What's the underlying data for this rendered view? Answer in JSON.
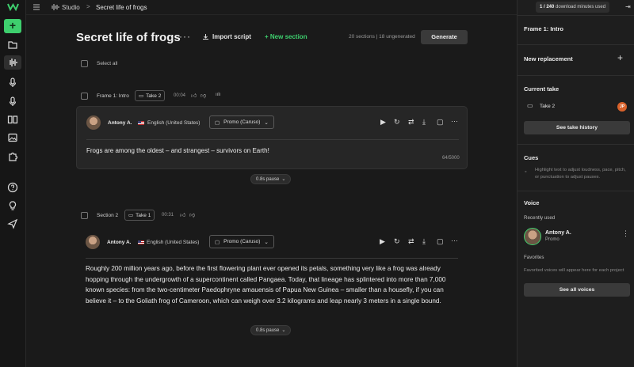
{
  "app": {
    "crumb_project": "Studio",
    "crumb_current": "Secret life of frogs",
    "crumb_sep": ">"
  },
  "rail": {
    "icons": [
      "logo-icon",
      "add-icon",
      "folder-icon",
      "waveform-icon",
      "mic-icon",
      "mic-alt-icon",
      "book-icon",
      "image-icon",
      "puzzle-icon",
      "help-icon",
      "lightbulb-icon",
      "send-icon"
    ]
  },
  "header": {
    "title": "Secret life of frogs",
    "more": "···",
    "import_label": "Import script",
    "new_section_label": "+ New section",
    "stats": "20 sections  |  18 ungenerated",
    "generate_label": "Generate",
    "select_all": "Select all"
  },
  "sections": [
    {
      "label": "Frame 1: Intro",
      "take": "Take 2",
      "duration": "00:04",
      "speaker": "Antony A.",
      "language": "English (United States)",
      "voice": "Promo (Caruso)",
      "text": "Frogs are among the oldest – and strangest – survivors on Earth!",
      "counter": "64/5000",
      "pause": "0.8s pause"
    },
    {
      "label": "Section 2",
      "take": "Take 1",
      "duration": "00:31",
      "speaker": "Antony A.",
      "language": "English (United States)",
      "voice": "Promo (Caruso)",
      "text": "Roughly 200 million years ago, before the first flowering plant ever opened its petals, something very like a frog was already hopping through the undergrowth of a supercontinent called Pangaea. Today, that lineage has splintered into more than 7,000 known species: from the two-centimeter Paedophryne amauensis of Papua New Guinea – smaller than a housefly, if you can believe it – to the Goliath frog of Cameroon, which can weigh over 3.2 kilograms and leap nearly 3 meters in a single bound.",
      "pause": "0.8s pause"
    }
  ],
  "panel": {
    "download_used": "1 / 240",
    "download_suffix": "download minutes used",
    "frame_title": "Frame 1: Intro",
    "new_replacement": "New replacement",
    "current_take": "Current take",
    "take_label": "Take 2",
    "take_badge": "JP",
    "take_history_btn": "See take history",
    "cues_title": "Cues",
    "cues_hint": "Highlight text to adjust loudness, pace, pitch, or punctuation to adjust pauses.",
    "voice_title": "Voice",
    "recently_used": "Recently used",
    "voice_name": "Antony A.",
    "voice_style": "Promo",
    "favorites": "Favorites",
    "favorites_hint": "Favorited voices will appear here for each project",
    "all_voices_btn": "See all voices"
  },
  "colors": {
    "accent": "#3ecf6e",
    "background": "#1a1a1a",
    "card": "#262626",
    "badge": "#d9622b"
  }
}
